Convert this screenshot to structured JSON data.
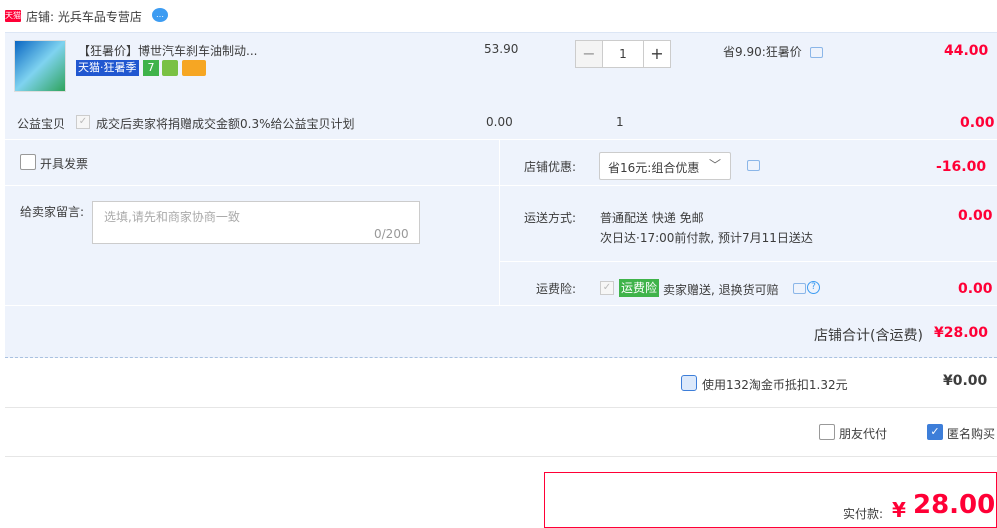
{
  "shop": {
    "name": "店铺: 光兵车品专营店",
    "logo_text": "天猫"
  },
  "item": {
    "title": "【狂暑价】博世汽车刹车油制动...",
    "tag_tmall": "天猫·狂暑季",
    "tag_7": "7",
    "price": "53.90",
    "qty": "1",
    "minus": "−",
    "plus": "+",
    "saving": "省9.90:狂暑价",
    "total": "44.00"
  },
  "charity": {
    "label": "公益宝贝",
    "text": "成交后卖家将捐赠成交金额0.3%给公益宝贝计划",
    "price": "0.00",
    "qty": "1",
    "total": "0.00"
  },
  "invoice": {
    "label": "开具发票"
  },
  "memo": {
    "label": "给卖家留言:",
    "placeholder": "选填,请先和商家协商一致",
    "count": "0/200"
  },
  "coupon": {
    "label": "店铺优惠:",
    "selected": "省16元:组合优惠",
    "value": "-16.00"
  },
  "shipping": {
    "label": "运送方式:",
    "line1": "普通配送 快递 免邮",
    "line2": "次日达·17:00前付款, 预计7月11日送达",
    "value": "0.00"
  },
  "insurance": {
    "label": "运费险:",
    "tag": "运费险",
    "text": "卖家赠送, 退换货可赔",
    "help": "?",
    "value": "0.00"
  },
  "subtotal": {
    "label": "店铺合计(含运费)",
    "value": "¥28.00"
  },
  "coins": {
    "text": "使用132淘金币抵扣1.32元",
    "value": "¥0.00"
  },
  "options": {
    "friend_pay": "朋友代付",
    "anonymous": "匿名购买"
  },
  "pay": {
    "label": "实付款:",
    "yen": "¥",
    "value": "28.00"
  },
  "colors": {
    "accent_red": "#ff0036",
    "panel_bg": "#eef3fc",
    "check_blue": "#3d7ed9"
  }
}
